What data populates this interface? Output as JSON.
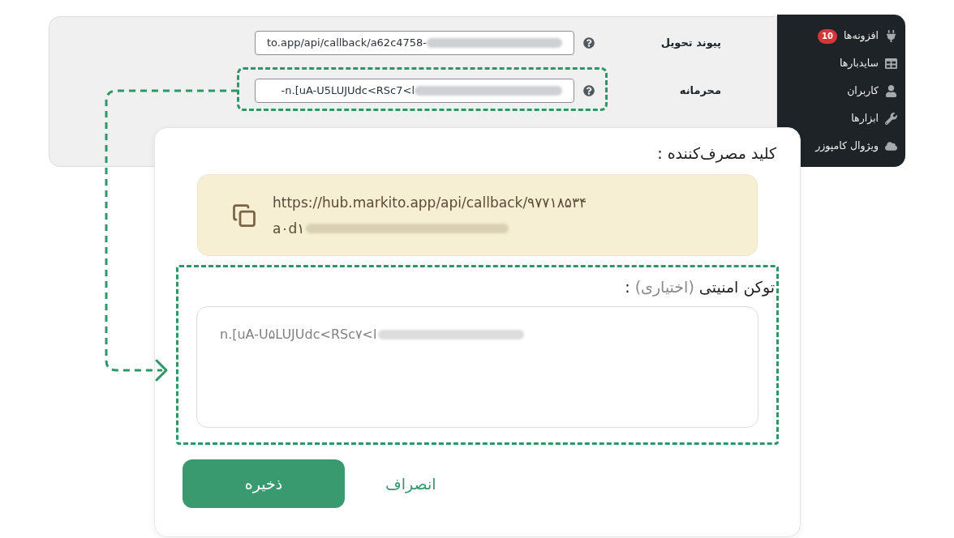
{
  "settings_panel": {
    "fields": [
      {
        "label": "پیوند تحویل",
        "value": "to.app/api/callback/a62c4758-",
        "redacted": true,
        "highlighted": false
      },
      {
        "label": "محرمانه",
        "value": "-n.[uA-U5LUJUdc<RSc7<l",
        "redacted": true,
        "highlighted": true
      }
    ]
  },
  "admin_menu": {
    "items": [
      {
        "kind": "plugins",
        "label": "افزونه‌ها",
        "badge": "10"
      },
      {
        "kind": "sidebars",
        "label": "سایدبارها"
      },
      {
        "kind": "users",
        "label": "کاربران"
      },
      {
        "kind": "tools",
        "label": "ابزارها"
      },
      {
        "kind": "composer",
        "label": "ویژوال کامپوزر"
      }
    ]
  },
  "dialog": {
    "consumer_key": {
      "label": "کلید مصرف‌کننده :",
      "lines": [
        "https://hub.markito.app/api/callback/۹۷۷۱۸۵۳۴",
        "a۰d۱"
      ],
      "redacted": true
    },
    "token": {
      "label": "توکن امنیتی",
      "optional": "(اختیاری)",
      "suffix": ":",
      "value": "n.[uA-U۵LUJUdc<RSc۷<l",
      "redacted": true,
      "highlighted": true
    },
    "buttons": [
      {
        "kind": "link",
        "label": "انصراف"
      },
      {
        "kind": "primary",
        "label": "ذخیره"
      }
    ]
  }
}
